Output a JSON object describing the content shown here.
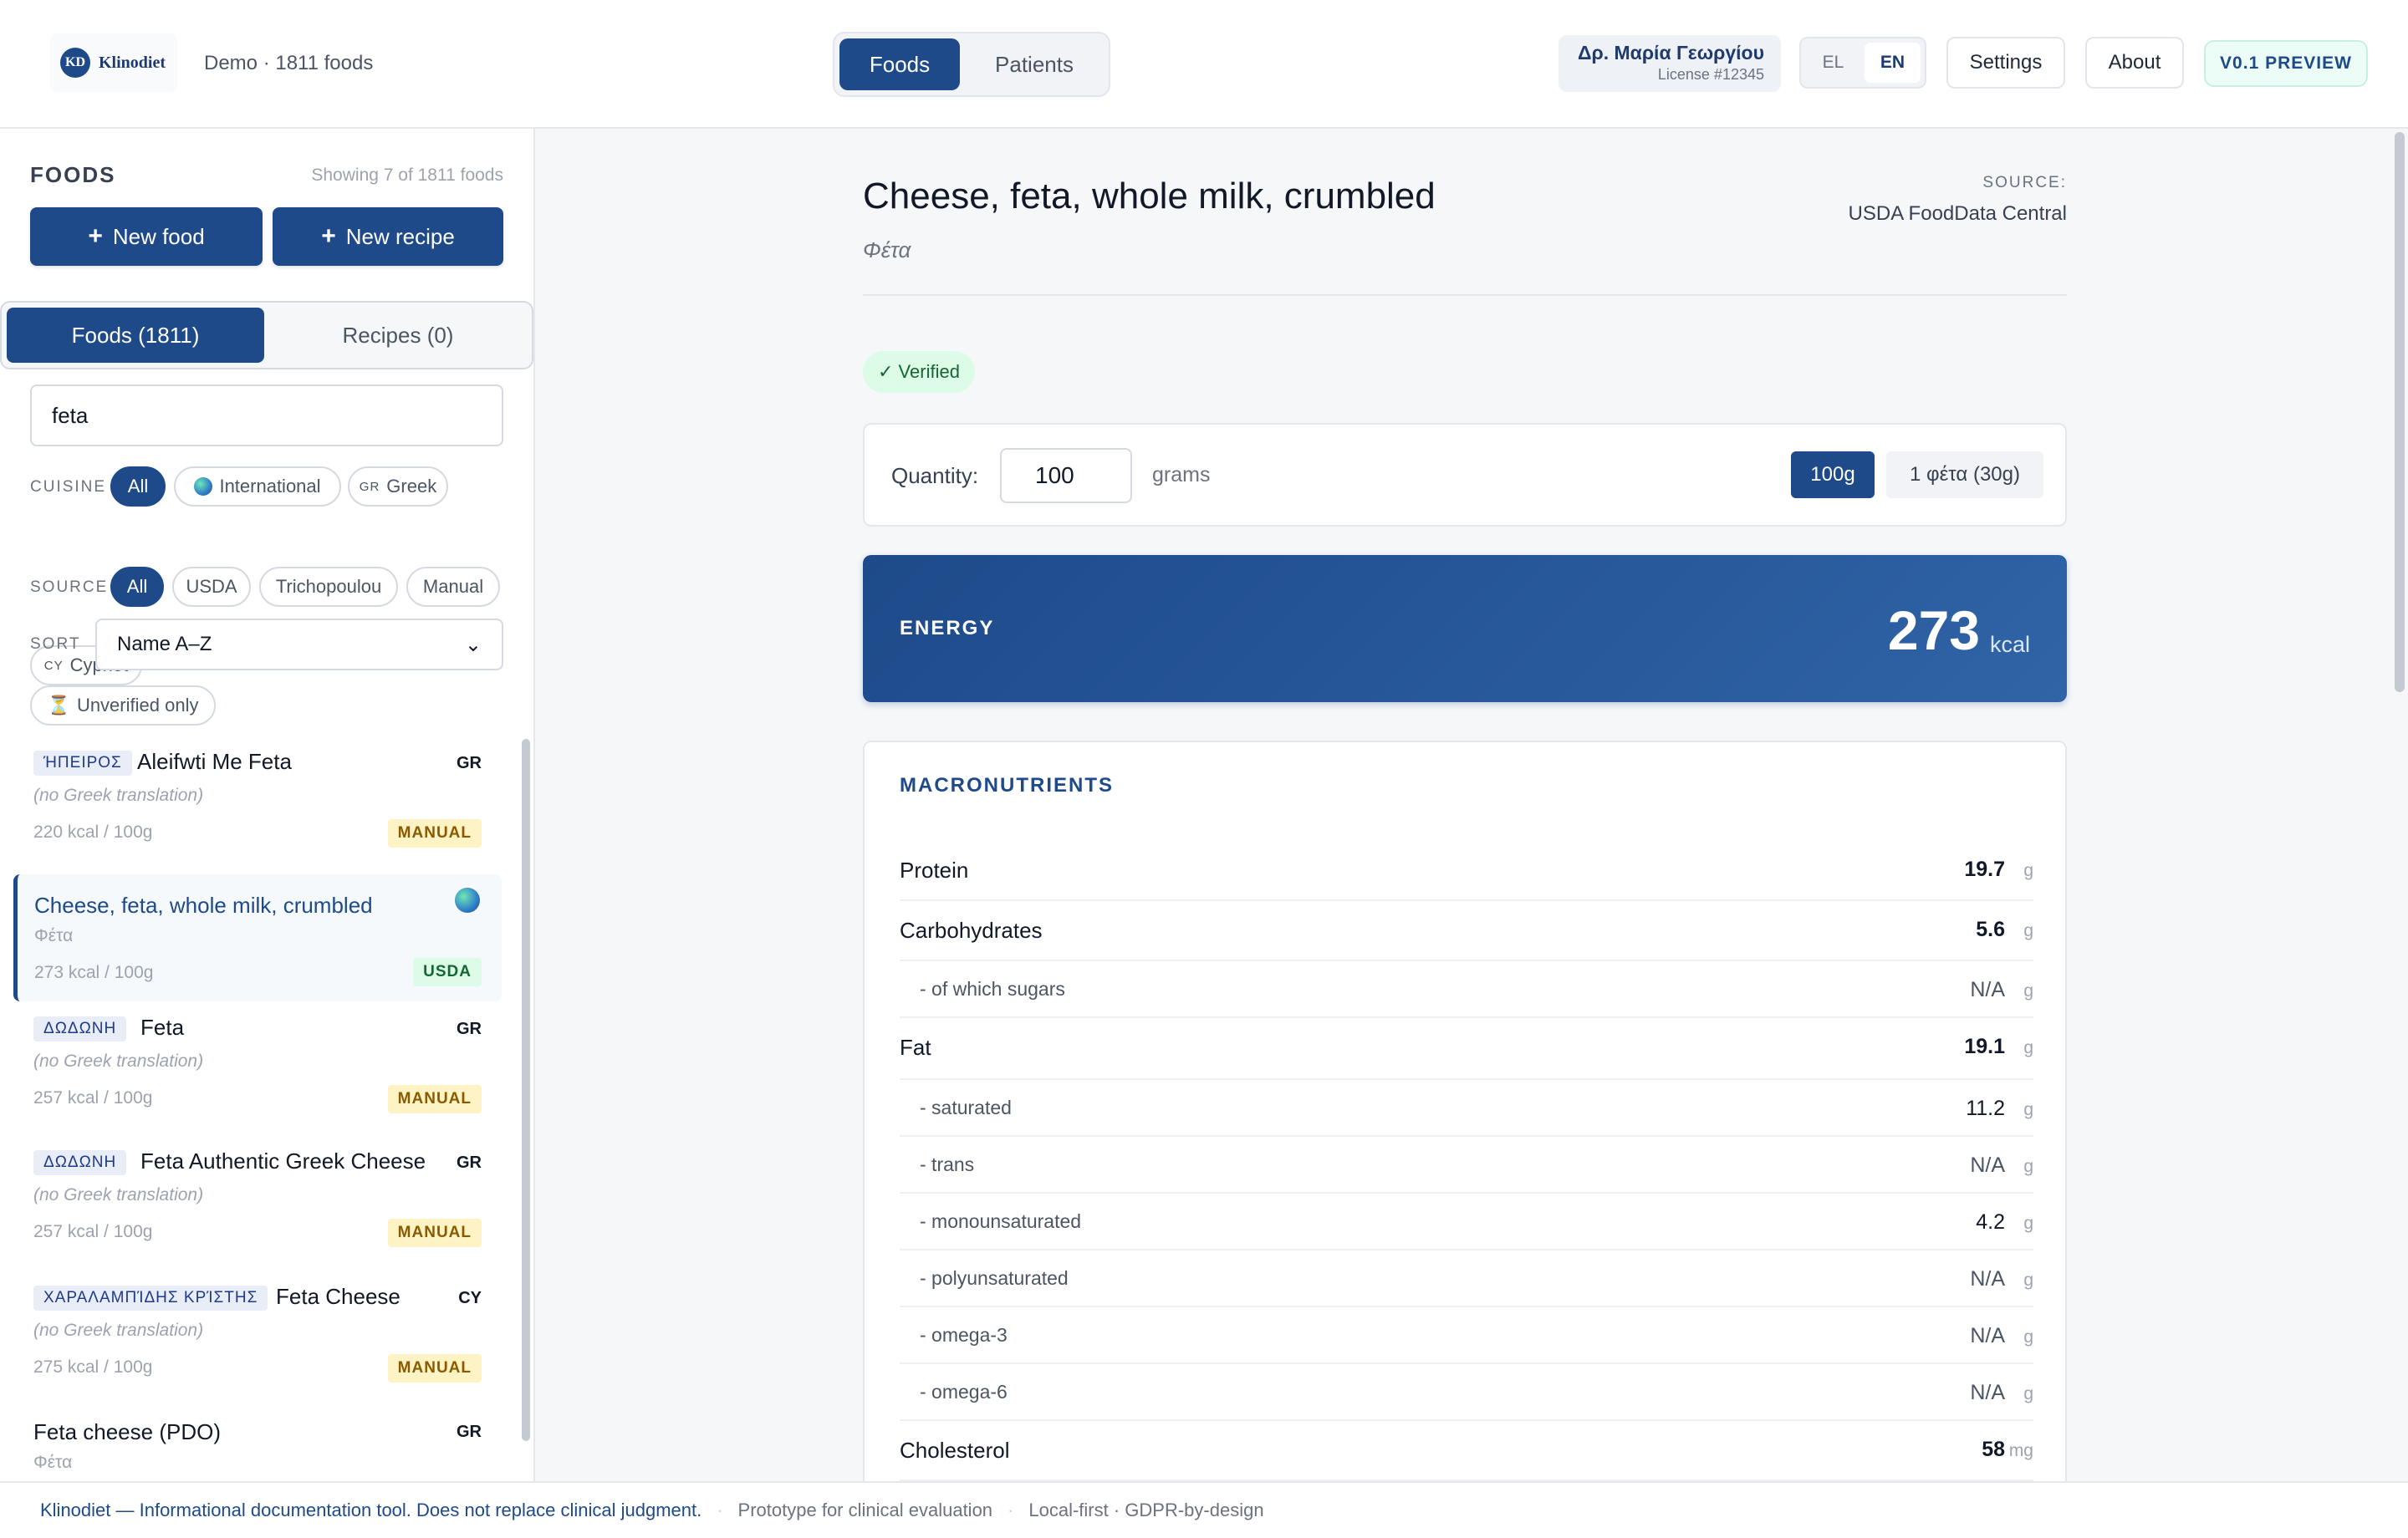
{
  "header": {
    "logo_text": "Klinodiet",
    "logo_mark": "KD",
    "demo_label": "Demo · 1811 foods",
    "tabs": [
      {
        "label": "Foods"
      },
      {
        "label": "Patients"
      }
    ],
    "user": {
      "name": "Δρ. Μαρία Γεωργίου",
      "license": "License #12345"
    },
    "languages": [
      "EL",
      "EN"
    ],
    "settings_label": "Settings",
    "about_label": "About",
    "version_label": "V0.1 PREVIEW"
  },
  "sidebar": {
    "title": "FOODS",
    "count": "Showing 7 of 1811 foods",
    "new_food_label": "New food",
    "new_recipe_label": "New recipe",
    "plus_icon": "+",
    "list_tabs": [
      "Foods (1811)",
      "Recipes (0)"
    ],
    "search_value": "feta",
    "cuisine_label": "CUISINE",
    "cuisine_options": [
      {
        "label": "All"
      },
      {
        "label": "International"
      },
      {
        "code": "GR",
        "label": "Greek"
      },
      {
        "code": "CY",
        "label": "Cypriot"
      }
    ],
    "source_label": "SOURCE",
    "source_options": [
      "All",
      "USDA",
      "Trichopoulou",
      "Manual"
    ],
    "sort_label": "SORT",
    "sort_value": "Name A–Z",
    "unverified_label": "Unverified only",
    "unverified_icon": "⏳",
    "foods": [
      {
        "brand": "ΉΠΕΙΡΟΣ",
        "name": "Aleifwti Me Feta",
        "origin": "GR",
        "sub": "(no Greek translation)",
        "kcal": "220 kcal / 100g",
        "badge": "MANUAL"
      },
      {
        "brand": "",
        "name": "Cheese, feta, whole milk, crumbled",
        "origin": "",
        "sub": "Φέτα",
        "kcal": "273 kcal / 100g",
        "badge": "USDA"
      },
      {
        "brand": "ΔΩΔΩΝΗ",
        "name": "Feta",
        "origin": "GR",
        "sub": "(no Greek translation)",
        "kcal": "257 kcal / 100g",
        "badge": "MANUAL"
      },
      {
        "brand": "ΔΩΔΩΝΗ",
        "name": "Feta Authentic Greek Cheese",
        "origin": "GR",
        "sub": "(no Greek translation)",
        "kcal": "257 kcal / 100g",
        "badge": "MANUAL"
      },
      {
        "brand": "ΧΑΡΑΛΑΜΠΊΔΗΣ ΚΡΊΣΤΗΣ",
        "name": "Feta Cheese",
        "origin": "CY",
        "sub": "(no Greek translation)",
        "kcal": "275 kcal / 100g",
        "badge": "MANUAL"
      },
      {
        "brand": "",
        "name": "Feta cheese (PDO)",
        "origin": "GR",
        "sub": "Φέτα",
        "kcal": "",
        "badge": ""
      }
    ]
  },
  "detail": {
    "title": "Cheese, feta, whole milk, crumbled",
    "greek_name": "Φέτα",
    "source_label": "SOURCE:",
    "source": "USDA FoodData Central",
    "verified_label": "✓ Verified",
    "quantity_label": "Quantity:",
    "quantity_value": "100",
    "quantity_unit": "grams",
    "portions": [
      "100g",
      "1 φέτα (30g)"
    ],
    "energy_label": "ENERGY",
    "energy_value": "273",
    "energy_unit": "kcal",
    "macros_title": "MACRONUTRIENTS",
    "macros": [
      {
        "name": "Protein",
        "value": "19.7",
        "unit": "g"
      },
      {
        "name": "Carbohydrates",
        "value": "5.6",
        "unit": "g"
      },
      {
        "name": "- of which sugars",
        "value": "N/A",
        "unit": "g"
      },
      {
        "name": "Fat",
        "value": "19.1",
        "unit": "g"
      },
      {
        "name": "- saturated",
        "value": "11.2",
        "unit": "g"
      },
      {
        "name": "- trans",
        "value": "N/A",
        "unit": "g"
      },
      {
        "name": "- monounsaturated",
        "value": "4.2",
        "unit": "g"
      },
      {
        "name": "- polyunsaturated",
        "value": "N/A",
        "unit": "g"
      },
      {
        "name": "- omega-3",
        "value": "N/A",
        "unit": "g"
      },
      {
        "name": "- omega-6",
        "value": "N/A",
        "unit": "g"
      },
      {
        "name": "Cholesterol",
        "value": "58",
        "unit": "mg"
      }
    ]
  },
  "footer": {
    "main": "Klinodiet — Informational documentation tool. Does not replace clinical judgment.",
    "sep": "·",
    "prototype": "Prototype for clinical evaluation",
    "local": "Local-first · GDPR-by-design"
  }
}
